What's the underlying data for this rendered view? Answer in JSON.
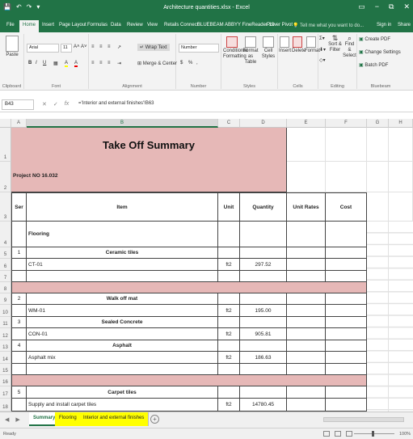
{
  "window": {
    "title": "Architecture quantities.xlsx - Excel",
    "controls": {
      "restore": "▭",
      "minimize": "−",
      "maximize": "⧉",
      "close": "✕"
    }
  },
  "qat": {
    "save": "💾",
    "undo": "↶",
    "redo": "↷",
    "customize": "▾"
  },
  "ribbon_tabs": [
    "File",
    "Home",
    "Insert",
    "Page Layout",
    "Formulas",
    "Data",
    "Review",
    "View",
    "Retails Connect",
    "BLUEBEAM",
    "ABBYY FineReader 12",
    "Power Pivot"
  ],
  "active_tab": "Home",
  "tellme": "Tell me what you want to do...",
  "signin": "Sign in",
  "share": "Share",
  "ribbon": {
    "clipboard": {
      "paste": "Paste",
      "label": "Clipboard"
    },
    "font": {
      "name": "Arial",
      "size": "11",
      "label": "Font",
      "bold": "B",
      "italic": "I",
      "underline": "U",
      "grow": "A˄",
      "shrink": "A˅",
      "fill": "A",
      "color": "A"
    },
    "alignment": {
      "wrap": "Wrap Text",
      "merge": "Merge & Center",
      "label": "Alignment"
    },
    "number": {
      "format": "Number",
      "currency": "$",
      "percent": "%",
      "comma": ",",
      "label": "Number"
    },
    "styles": {
      "conditional": "Conditional Formatting",
      "format_table": "Format as Table",
      "cell_styles": "Cell Styles",
      "label": "Styles"
    },
    "cells": {
      "insert": "Insert",
      "delete": "Delete",
      "format": "Format",
      "label": "Cells"
    },
    "editing": {
      "sort": "Sort & Filter",
      "find": "Find & Select",
      "label": "Editing"
    },
    "bluebeam": {
      "create": "Create PDF",
      "change": "Change Settings",
      "batch": "Batch PDF",
      "label": "Bluebeam"
    }
  },
  "formula_bar": {
    "name_box": "B43",
    "cancel": "✕",
    "enter": "✓",
    "fx": "fx",
    "content": "='Interior and external finishes'!B63"
  },
  "columns": [
    "A",
    "B",
    "C",
    "D",
    "E",
    "F",
    "G",
    "H"
  ],
  "selected_column": "B",
  "rows": [
    "1",
    "2",
    "3",
    "4",
    "5",
    "6",
    "7",
    "8",
    "9",
    "10",
    "11",
    "12",
    "13",
    "14",
    "15",
    "16",
    "17",
    "18"
  ],
  "sheet": {
    "title": "Take Off Summary",
    "project_label": "Project",
    "project_no": "NO 16.032",
    "headers": {
      "ser": "Ser",
      "item": "Item",
      "unit": "Unit",
      "quantity": "Quantity",
      "rates": "Unit Rates",
      "cost": "Cost"
    },
    "section_flooring": "Flooring",
    "r5": {
      "ser": "1",
      "item": "Ceramic tiles"
    },
    "r6": {
      "item": "CT-01",
      "unit": "ft2",
      "qty": "297.52"
    },
    "r9": {
      "ser": "2",
      "item": "Walk off mat"
    },
    "r10": {
      "item": "WM-01",
      "unit": "ft2",
      "qty": "195.00"
    },
    "r11": {
      "ser": "3",
      "item": "Sealed Concrete"
    },
    "r12": {
      "item": "CON-01",
      "unit": "ft2",
      "qty": "905.81"
    },
    "r13": {
      "ser": "4",
      "item": "Asphalt"
    },
    "r14": {
      "item": "Asphalt mix",
      "unit": "ft2",
      "qty": "186.63"
    },
    "r17": {
      "ser": "5",
      "item": "Carpet tiles"
    },
    "r18": {
      "item": "Supply and install carpet tiles",
      "unit": "ft2",
      "qty": "14780.45"
    }
  },
  "sheet_tabs": [
    "Summary",
    "Flooring",
    "Interior and external finishes"
  ],
  "active_sheet": "Summary",
  "status": {
    "ready": "Ready",
    "zoom": "100%"
  },
  "colors": {
    "excel_green": "#217346",
    "pink": "#e6b8b7",
    "tab_yellow": "#ffff00"
  }
}
